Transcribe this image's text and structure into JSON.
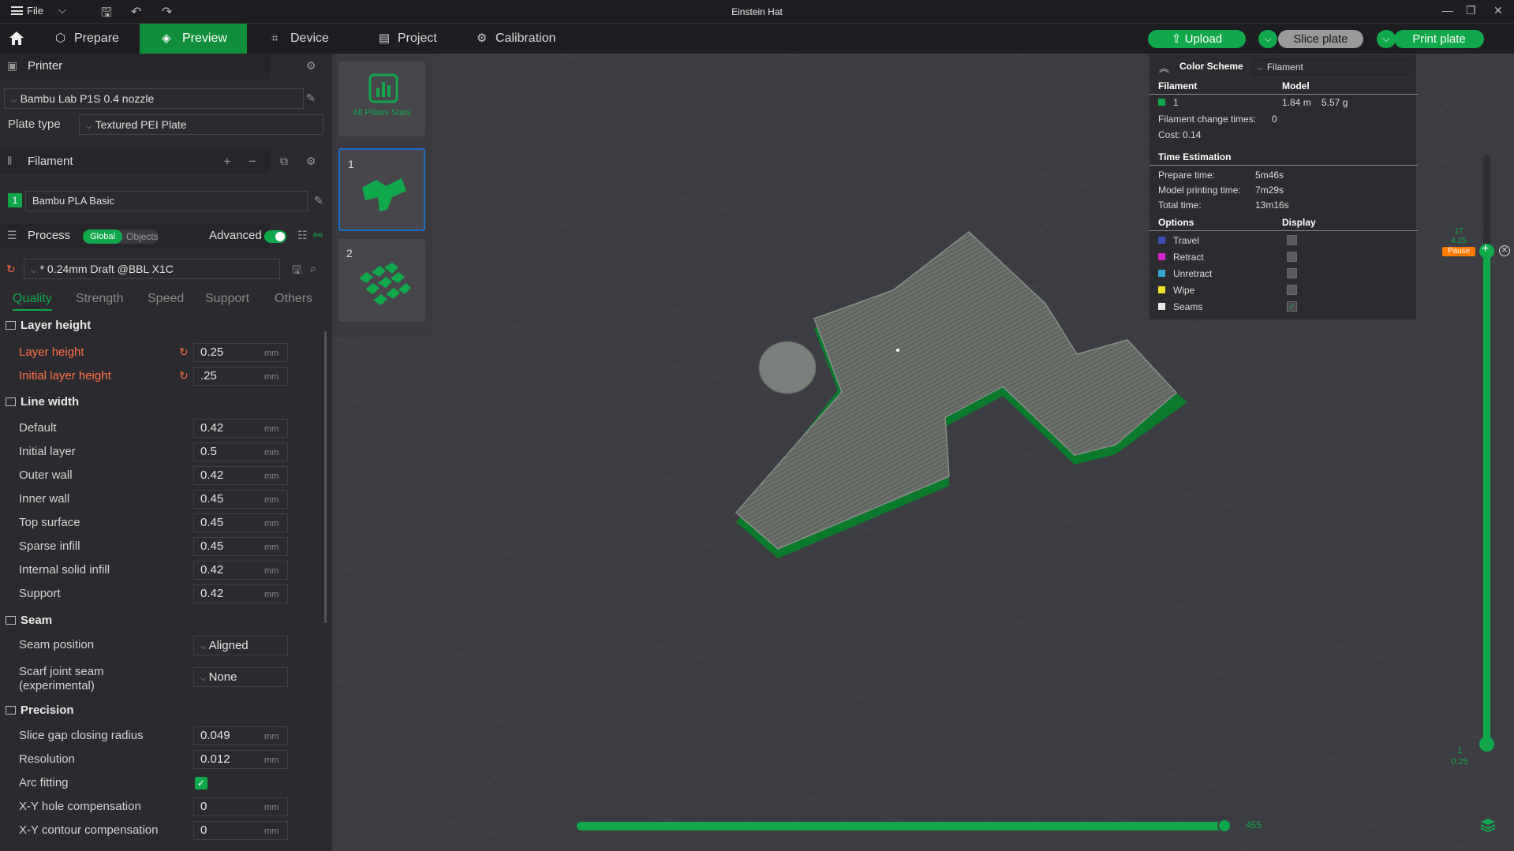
{
  "window": {
    "title": "Einstein Hat",
    "file_menu": "File"
  },
  "tabs": [
    {
      "label": "Prepare",
      "icon": "cube-icon"
    },
    {
      "label": "Preview",
      "icon": "layers-icon"
    },
    {
      "label": "Device",
      "icon": "device-icon"
    },
    {
      "label": "Project",
      "icon": "project-icon"
    },
    {
      "label": "Calibration",
      "icon": "calibration-icon"
    }
  ],
  "actions": {
    "upload": "Upload",
    "slice": "Slice plate",
    "print": "Print plate"
  },
  "printer": {
    "section": "Printer",
    "name": "Bambu Lab P1S 0.4 nozzle",
    "plate_type_label": "Plate type",
    "plate_type": "Textured PEI Plate"
  },
  "filament": {
    "section": "Filament",
    "index": "1",
    "name": "Bambu PLA Basic",
    "color": "#11a84c"
  },
  "process": {
    "section": "Process",
    "toggle_global": "Global",
    "toggle_objects": "Objects",
    "advanced_label": "Advanced",
    "advanced_on": true,
    "preset": "* 0.24mm Draft @BBL X1C",
    "subtabs": [
      "Quality",
      "Strength",
      "Speed",
      "Support",
      "Others"
    ]
  },
  "quality": {
    "layer_height": {
      "title": "Layer height",
      "rows": [
        {
          "label": "Layer height",
          "value": "0.25",
          "unit": "mm",
          "modified": true
        },
        {
          "label": "Initial layer height",
          "value": ".25",
          "unit": "mm",
          "modified": true
        }
      ]
    },
    "line_width": {
      "title": "Line width",
      "rows": [
        {
          "label": "Default",
          "value": "0.42",
          "unit": "mm"
        },
        {
          "label": "Initial layer",
          "value": "0.5",
          "unit": "mm"
        },
        {
          "label": "Outer wall",
          "value": "0.42",
          "unit": "mm"
        },
        {
          "label": "Inner wall",
          "value": "0.45",
          "unit": "mm"
        },
        {
          "label": "Top surface",
          "value": "0.45",
          "unit": "mm"
        },
        {
          "label": "Sparse infill",
          "value": "0.45",
          "unit": "mm"
        },
        {
          "label": "Internal solid infill",
          "value": "0.42",
          "unit": "mm"
        },
        {
          "label": "Support",
          "value": "0.42",
          "unit": "mm"
        }
      ]
    },
    "seam": {
      "title": "Seam",
      "position_label": "Seam position",
      "position_value": "Aligned",
      "scarf_label_1": "Scarf joint seam",
      "scarf_label_2": "(experimental)",
      "scarf_value": "None"
    },
    "precision": {
      "title": "Precision",
      "rows": [
        {
          "label": "Slice gap closing radius",
          "value": "0.049",
          "unit": "mm"
        },
        {
          "label": "Resolution",
          "value": "0.012",
          "unit": "mm"
        }
      ],
      "arc_fitting_label": "Arc fitting",
      "arc_fitting": true,
      "rows2": [
        {
          "label": "X-Y hole compensation",
          "value": "0",
          "unit": "mm"
        },
        {
          "label": "X-Y contour compensation",
          "value": "0",
          "unit": "mm"
        }
      ]
    }
  },
  "plates": {
    "all_stats": "All Plates Stats",
    "items": [
      "1",
      "2"
    ]
  },
  "legend": {
    "color_scheme_label": "Color Scheme",
    "color_scheme_value": "Filament",
    "col_filament": "Filament",
    "col_model": "Model",
    "filament_row": {
      "index": "1",
      "length": "1.84 m",
      "weight": "5.57 g"
    },
    "change_times_label": "Filament change times:",
    "change_times": "0",
    "cost_label": "Cost:",
    "cost": "0.14",
    "time_title": "Time Estimation",
    "times": [
      {
        "label": "Prepare time:",
        "value": "5m46s"
      },
      {
        "label": "Model printing time:",
        "value": "7m29s"
      },
      {
        "label": "Total time:",
        "value": "13m16s"
      }
    ],
    "col_options": "Options",
    "col_display": "Display",
    "options": [
      {
        "label": "Travel",
        "color": "#3f4fb5",
        "checked": false
      },
      {
        "label": "Retract",
        "color": "#d524c8",
        "checked": false
      },
      {
        "label": "Unretract",
        "color": "#36a6d6",
        "checked": false
      },
      {
        "label": "Wipe",
        "color": "#f2e22c",
        "checked": false
      },
      {
        "label": "Seams",
        "color": "#e8e8e8",
        "checked": true
      }
    ]
  },
  "sliders": {
    "horizontal_value": "455",
    "layer_top": "17",
    "layer_top_height": "4.25",
    "layer_bottom": "1",
    "layer_bottom_height": "0.25",
    "pause_label": "Pause"
  }
}
